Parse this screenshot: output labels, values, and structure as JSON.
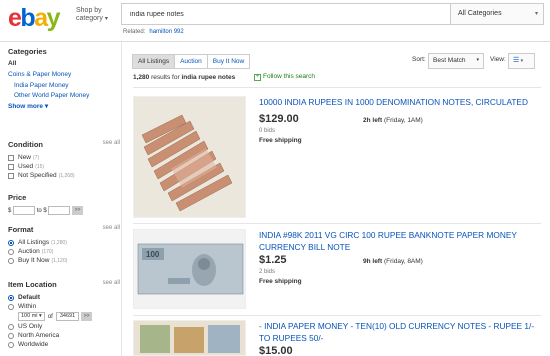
{
  "logo": {
    "e": "e",
    "b": "b",
    "a": "a",
    "y": "y"
  },
  "header": {
    "shop_by_category": "Shop by category",
    "search_value": "india rupee notes",
    "category_select": "All Categories",
    "related_label": "Related:",
    "related_link": "hamilton 992"
  },
  "sidebar": {
    "categories_title": "Categories",
    "all_label": "All",
    "cat1": "Coins & Paper Money",
    "cat2": "India Paper Money",
    "cat3": "Other World Paper Money",
    "show_more": "Show more",
    "condition": {
      "title": "Condition",
      "see_all": "see all",
      "items": [
        {
          "label": "New",
          "count": "(7)"
        },
        {
          "label": "Used",
          "count": "(15)"
        },
        {
          "label": "Not Specified",
          "count": "(1,268)"
        }
      ]
    },
    "price": {
      "title": "Price",
      "from": "$",
      "to": "to $",
      "go": ">>"
    },
    "format": {
      "title": "Format",
      "see_all": "see all",
      "items": [
        {
          "label": "All Listings",
          "count": "(1,280)"
        },
        {
          "label": "Auction",
          "count": "(170)"
        },
        {
          "label": "Buy It Now",
          "count": "(1,120)"
        }
      ]
    },
    "location": {
      "title": "Item Location",
      "see_all": "see all",
      "default": "Default",
      "within": "Within",
      "distance": "100 mi",
      "of": "of",
      "zip": "34691",
      "us_only": "US Only",
      "north_america": "North America",
      "worldwide": "Worldwide"
    }
  },
  "toolbar": {
    "tabs": [
      "All Listings",
      "Auction",
      "Buy It Now"
    ],
    "sort_label": "Sort:",
    "sort_value": "Best Match",
    "view_label": "View:",
    "view_icon": "list-view-icon"
  },
  "results": {
    "count": "1,280",
    "text": "results for",
    "query": "india rupee notes",
    "follow": "Follow this search"
  },
  "listings": [
    {
      "title": "10000 INDIA RUPEES IN 1000 DENOMINATION NOTES, CIRCULATED",
      "price": "$129.00",
      "bids": "0 bids",
      "shipping": "Free shipping",
      "time_left": "2h left",
      "end": "(Friday, 1AM)"
    },
    {
      "title": "INDIA #98K 2011 VG CIRC 100 RUPEE BANKNOTE PAPER MONEY CURRENCY BILL NOTE",
      "price": "$1.25",
      "bids": "2 bids",
      "shipping": "Free shipping",
      "time_left": "9h left",
      "end": "(Friday, 8AM)"
    },
    {
      "title": "- INDIA PAPER MONEY - TEN(10) OLD CURRENCY NOTES - RUPEE 1/- TO RUPEES 50/-",
      "price": "$15.00"
    }
  ],
  "colors": {
    "link": "#0654ba",
    "follow_green": "#1a7f1a"
  }
}
